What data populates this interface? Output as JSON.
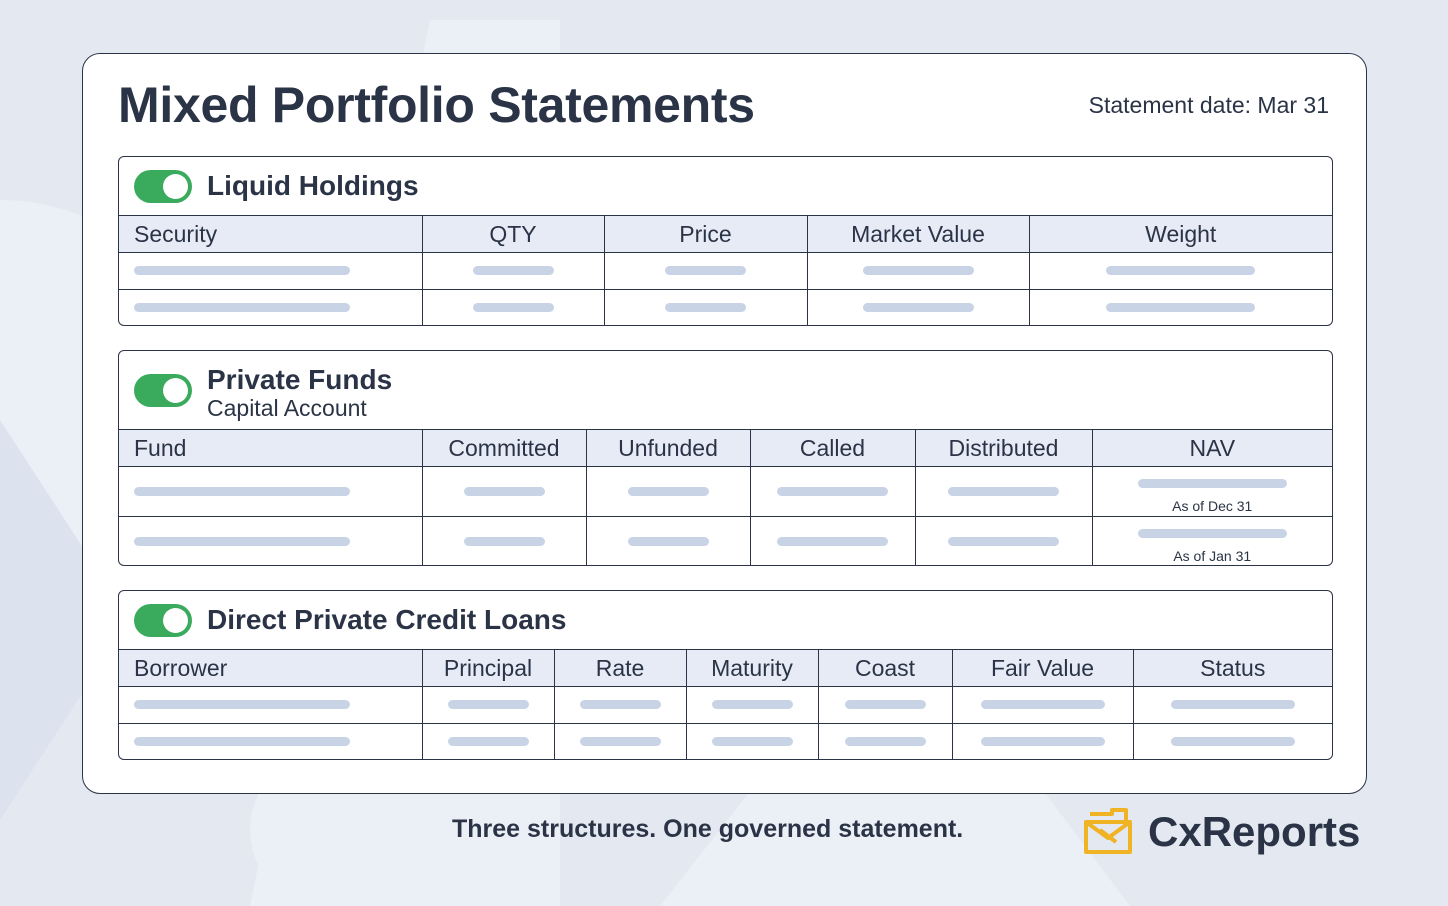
{
  "header": {
    "title": "Mixed Portfolio Statements",
    "statement_date": "Statement date: Mar 31"
  },
  "sections": [
    {
      "title": "Liquid Holdings",
      "toggle_on": true,
      "columns": [
        "Security",
        "QTY",
        "Price",
        "Market Value",
        "Weight"
      ]
    },
    {
      "title": "Private Funds",
      "subtitle": "Capital Account",
      "toggle_on": true,
      "columns": [
        "Fund",
        "Committed",
        "Unfunded",
        "Called",
        "Distributed",
        "NAV"
      ],
      "nav_notes": [
        "As of Dec 31",
        "As of Jan 31"
      ]
    },
    {
      "title": "Direct Private Credit Loans",
      "toggle_on": true,
      "columns": [
        "Borrower",
        "Principal",
        "Rate",
        "Maturity",
        "Coast",
        "Fair Value",
        "Status"
      ]
    }
  ],
  "footer": {
    "tagline": "Three structures. One governed statement.",
    "brand": "CxReports"
  },
  "colors": {
    "background": "#e3e8f1",
    "text": "#2b3446",
    "header_row": "#e6ebf6",
    "placeholder_bar": "#c9d3e6",
    "toggle_on": "#3aaa5c",
    "logo_accent": "#f0b323"
  }
}
